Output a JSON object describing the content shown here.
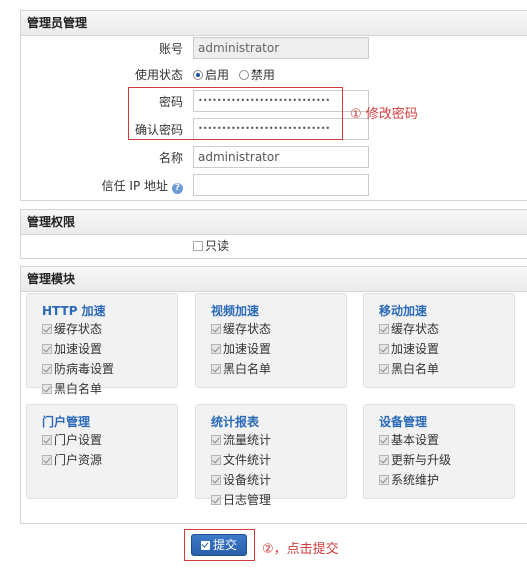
{
  "admin_section": {
    "title": "管理员管理",
    "account_label": "账号",
    "account_value": "administrator",
    "status_label": "使用状态",
    "status_options": [
      "启用",
      "禁用"
    ],
    "status_selected": "启用",
    "password_label": "密码",
    "password_value": "••••••••••••••••••••••••••••",
    "confirm_password_label": "确认密码",
    "confirm_password_value": "••••••••••••••••••••••••••••",
    "name_label": "名称",
    "name_value": "administrator",
    "trusted_ip_label": "信任 IP 地址",
    "trusted_ip_value": ""
  },
  "permissions_section": {
    "title": "管理权限",
    "readonly_label": "只读",
    "readonly_checked": false
  },
  "modules_section": {
    "title": "管理模块",
    "modules": [
      {
        "title": "HTTP 加速",
        "items": [
          "缓存状态",
          "加速设置",
          "防病毒设置",
          "黑白名单"
        ]
      },
      {
        "title": "视频加速",
        "items": [
          "缓存状态",
          "加速设置",
          "黑白名单"
        ]
      },
      {
        "title": "移动加速",
        "items": [
          "缓存状态",
          "加速设置",
          "黑白名单"
        ]
      },
      {
        "title": "门户管理",
        "items": [
          "门户设置",
          "门户资源"
        ]
      },
      {
        "title": "统计报表",
        "items": [
          "流量统计",
          "文件统计",
          "设备统计",
          "日志管理"
        ]
      },
      {
        "title": "设备管理",
        "items": [
          "基本设置",
          "更新与升级",
          "系统维护"
        ]
      }
    ]
  },
  "annotations": {
    "note1": "① 修改密码",
    "note2": "②，点击提交",
    "color": "#d23b3b"
  },
  "submit": {
    "label": "提交"
  },
  "colors": {
    "accent": "#2a6ab8",
    "button": "#2a5fa8"
  }
}
